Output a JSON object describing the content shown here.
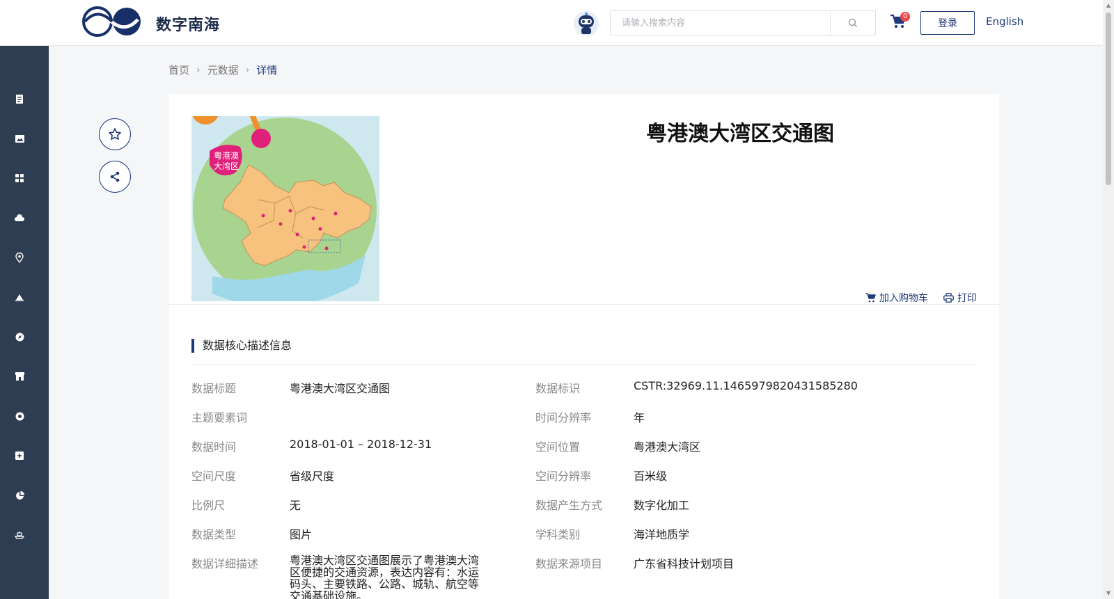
{
  "header": {
    "site_name": "数字南海",
    "search_placeholder": "请输入搜索内容",
    "cart_count": "0",
    "login_label": "登录",
    "language_label": "English"
  },
  "sidebar": {
    "icons": [
      "document-icon",
      "image-icon",
      "grid-icon",
      "cloud-icon",
      "location-icon",
      "triangle-icon",
      "compass-icon",
      "shop-icon",
      "globe-icon",
      "plus-icon",
      "pie-icon",
      "ship-icon"
    ]
  },
  "breadcrumb": {
    "home": "首页",
    "metadata": "元数据",
    "current": "详情"
  },
  "detail": {
    "title": "粤港澳大湾区交通图",
    "add_to_cart": "加入购物车",
    "print": "打印",
    "map_tag_line1": "粤港澳",
    "map_tag_line2": "大湾区"
  },
  "section": {
    "title": "数据核心描述信息"
  },
  "fields": [
    {
      "label": "数据标题",
      "value": "粤港澳大湾区交通图"
    },
    {
      "label": "数据标识",
      "value": "CSTR:32969.11.1465979820431585280"
    },
    {
      "label": "主题要素词",
      "value": ""
    },
    {
      "label": "时间分辨率",
      "value": "年"
    },
    {
      "label": "数据时间",
      "value": "2018-01-01 – 2018-12-31"
    },
    {
      "label": "空间位置",
      "value": "粤港澳大湾区"
    },
    {
      "label": "空间尺度",
      "value": "省级尺度"
    },
    {
      "label": "空间分辨率",
      "value": "百米级"
    },
    {
      "label": "比例尺",
      "value": "无"
    },
    {
      "label": "数据产生方式",
      "value": "数字化加工"
    },
    {
      "label": "数据类型",
      "value": "图片"
    },
    {
      "label": "学科类别",
      "value": "海洋地质学"
    },
    {
      "label": "数据详细描述",
      "value": "粤港澳大湾区交通图展示了粤港澳大湾区便捷的交通资源，表达内容有：水运码头、主要铁路、公路、城轨、航空等交通基础设施。"
    },
    {
      "label": "数据来源项目",
      "value": "广东省科技计划项目"
    }
  ],
  "colors": {
    "primary": "#1f3a7a",
    "sidebar": "#2f3d52",
    "badge": "#f04848"
  }
}
